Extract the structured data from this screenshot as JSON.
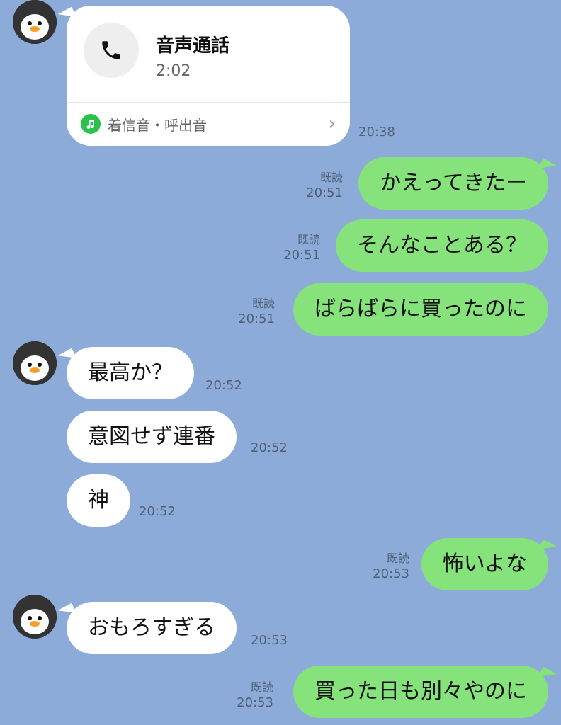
{
  "call": {
    "title": "音声通話",
    "duration": "2:02",
    "footer_label": "着信音・呼出音",
    "time": "20:38"
  },
  "read_label": "既読",
  "messages": [
    {
      "side": "out",
      "text": "かえってきたー",
      "time": "20:51"
    },
    {
      "side": "out",
      "text": "そんなことある？",
      "time": "20:51"
    },
    {
      "side": "out",
      "text": "ばらばらに買ったのに",
      "time": "20:51"
    },
    {
      "side": "in",
      "text": "最高か？",
      "time": "20:52"
    },
    {
      "side": "in",
      "text": "意図せず連番",
      "time": "20:52"
    },
    {
      "side": "in",
      "text": "神",
      "time": "20:52"
    },
    {
      "side": "out",
      "text": "怖いよな",
      "time": "20:53"
    },
    {
      "side": "in",
      "text": "おもろすぎる",
      "time": "20:53"
    },
    {
      "side": "out",
      "text": "買った日も別々やのに",
      "time": "20:53"
    }
  ],
  "colors": {
    "background": "#8cabd8",
    "incoming_bubble": "#ffffff",
    "outgoing_bubble": "#86e27a",
    "music_badge": "#2ac14a"
  },
  "icons": {
    "avatar": "penguin-avatar",
    "call": "phone-icon",
    "music": "music-note-icon",
    "chevron": "chevron-right-icon"
  }
}
